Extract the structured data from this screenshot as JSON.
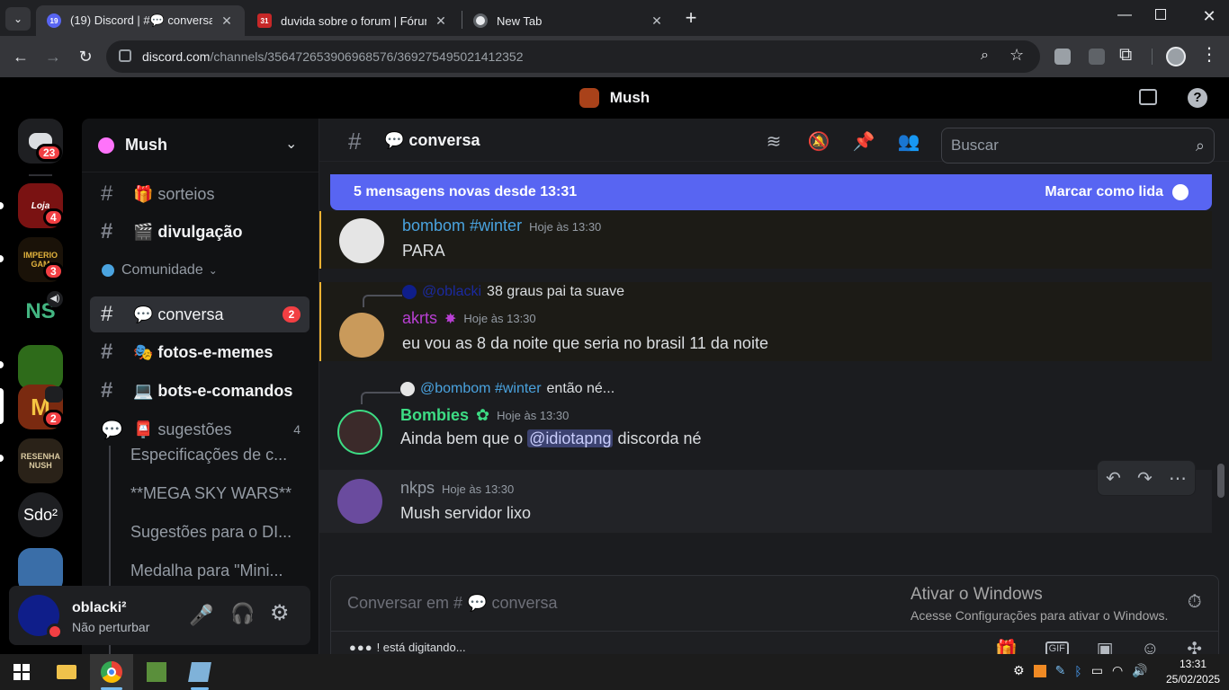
{
  "browser": {
    "tabs": [
      {
        "title": "(19) Discord | #💬 conversa | Mush",
        "badge": "19",
        "active": true
      },
      {
        "title": "duvida sobre o forum | Fórum Mush",
        "badge": "31",
        "active": false
      },
      {
        "title": "New Tab",
        "active": false
      }
    ],
    "url_host": "discord.com",
    "url_path": "/channels/356472653906968576/369275495021412352"
  },
  "discord": {
    "server_title": "Mush",
    "home_badge": "23",
    "servers": [
      {
        "label": "Loja",
        "badge": "4",
        "color": "#7a1212"
      },
      {
        "label": "IMPERIO GAM",
        "badge": "3",
        "color": "#1a1208"
      },
      {
        "label": "NS",
        "badge": "",
        "color": "#000000"
      },
      {
        "label": "",
        "badge": "",
        "color": "#2e6b1a"
      },
      {
        "label": "M",
        "badge": "2",
        "color": "#7a2a10"
      },
      {
        "label": "RESENHA NUSH",
        "badge": "",
        "color": "#2a2218"
      },
      {
        "label": "Sdo²",
        "badge": "",
        "color": "#1e1f22"
      },
      {
        "label": "",
        "badge": "",
        "color": "#3a6ea8"
      }
    ],
    "sidebar": {
      "server_name": "Mush",
      "channels_top": [
        {
          "name": "🎁 sorteios"
        },
        {
          "name": "🎬 divulgação"
        }
      ],
      "category": "Comunidade",
      "channels": [
        {
          "name": "💬 conversa",
          "badge": "2",
          "active": true
        },
        {
          "name": "🎭 fotos-e-memes"
        },
        {
          "name": "💻 bots-e-comandos"
        }
      ],
      "forum": {
        "name": "📮 sugestões",
        "count": "4"
      },
      "threads": [
        "Especificações de c...",
        "**MEGA SKY WARS**",
        "Sugestões para o DI...",
        "Medalha para \"Mini..."
      ]
    },
    "user": {
      "name": "oblacki²",
      "status": "Não perturbar"
    },
    "channel": {
      "name": "💬 conversa",
      "search_placeholder": "Buscar"
    },
    "new_messages": {
      "text": "5 mensagens novas desde 13:31",
      "action": "Marcar como lida"
    },
    "messages": [
      {
        "author": "bombom #winter",
        "time": "Hoje às 13:30",
        "text": "PARA",
        "color": "#4aa3df"
      },
      {
        "reply_to": "@oblacki",
        "reply_text": "38 graus pai ta suave",
        "author": "akrts",
        "time": "Hoje às 13:30",
        "text": "eu vou as 8 da noite que seria no brasil 11 da noite",
        "color": "#b83fd3"
      },
      {
        "reply_to": "@bombom #winter",
        "reply_text": "então né...",
        "author": "Bombies",
        "time": "Hoje às 13:30",
        "text_before": "Ainda bem que o",
        "mention": "@idiotapng",
        "text_after": "discorda né",
        "color": "#3ddc84"
      },
      {
        "author": "nkps",
        "time": "Hoje às 13:30",
        "text": "Mush servidor lixo",
        "color": "#949ba4"
      }
    ],
    "composer": {
      "placeholder": "Conversar em # 💬 conversa",
      "typing": "! está digitando..."
    }
  },
  "watermark": {
    "line1": "Ativar o Windows",
    "line2": "Acesse Configurações para ativar o Windows."
  },
  "taskbar": {
    "time": "13:31",
    "date": "25/02/2025"
  }
}
